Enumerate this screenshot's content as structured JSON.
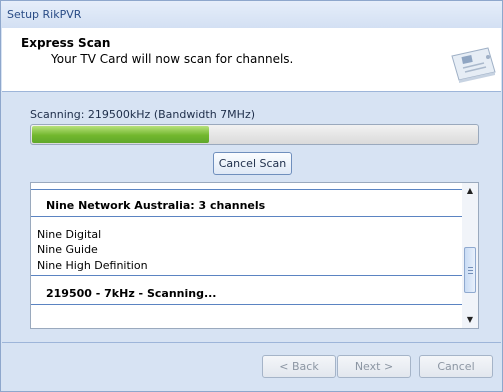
{
  "window": {
    "title": "Setup RikPVR"
  },
  "header": {
    "title": "Express Scan",
    "subtitle": "Your TV Card will now scan for channels.",
    "icon": "tv-card-icon"
  },
  "scan": {
    "status": "Scanning: 219500kHz (Bandwidth 7MHz)",
    "progress_percent": 40,
    "cancel_label": "Cancel Scan"
  },
  "results": {
    "network_header": "Nine Network Australia: 3 channels",
    "channels": [
      "Nine Digital",
      "Nine Guide",
      "Nine High Definition"
    ],
    "scanning_line": "219500 - 7kHz - Scanning..."
  },
  "scrollbar": {
    "up_arrow": "▲",
    "down_arrow": "▼"
  },
  "buttons": {
    "back": "< Back",
    "next": "Next >",
    "cancel": "Cancel"
  },
  "colors": {
    "accent": "#2a4c86",
    "progress": "#72b72e",
    "background": "#d7e3f3"
  }
}
